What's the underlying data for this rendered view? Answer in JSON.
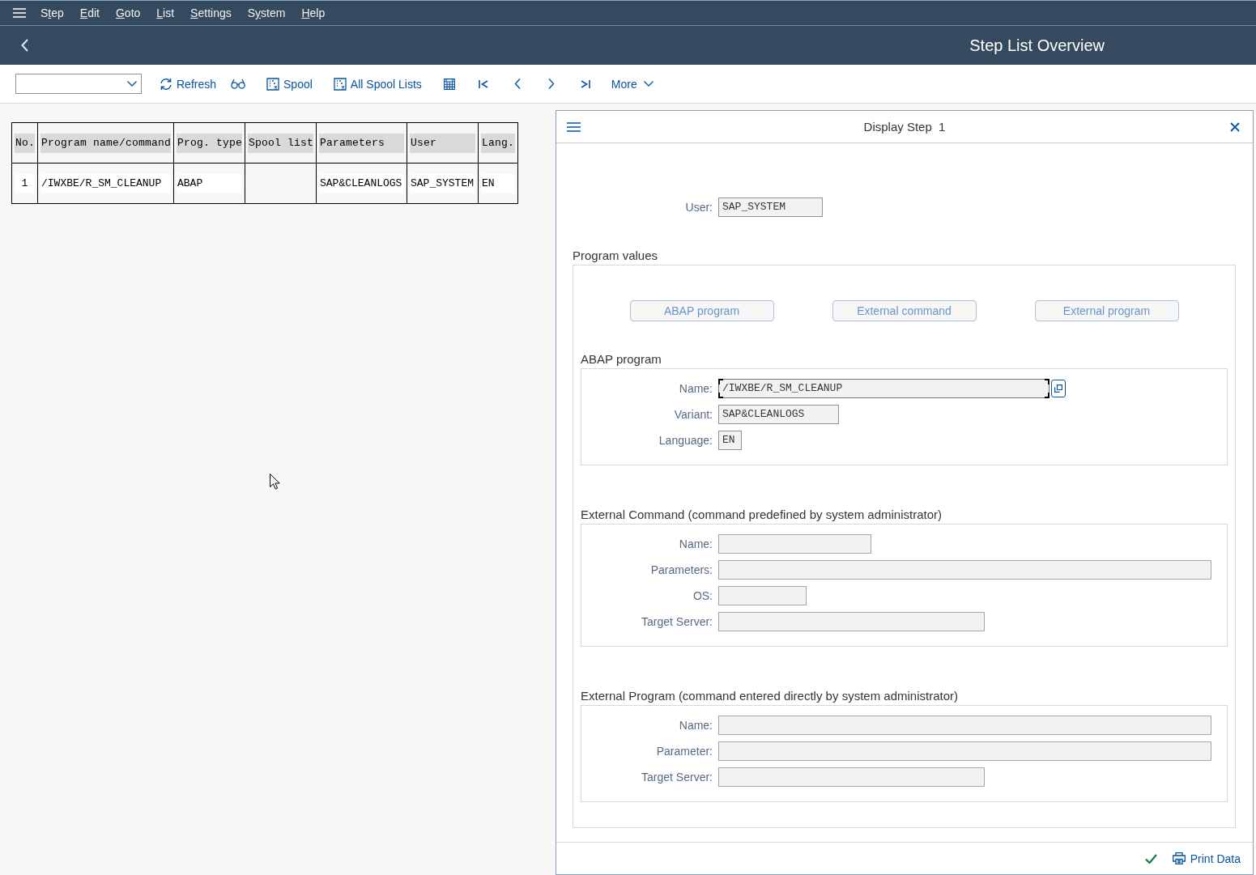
{
  "menu_bar": {
    "items": [
      {
        "before": "S",
        "underlined": "t",
        "after": "ep"
      },
      {
        "underlined": "E",
        "after": "dit"
      },
      {
        "underlined": "G",
        "after": "oto"
      },
      {
        "underlined": "L",
        "after": "ist"
      },
      {
        "underlined": "S",
        "after": "ettings"
      },
      {
        "before": "S",
        "underlined": "y",
        "after": "stem"
      },
      {
        "underlined": "H",
        "after": "elp"
      }
    ]
  },
  "title_bar": {
    "title": "Step List Overview"
  },
  "toolbar": {
    "refresh": "Refresh",
    "spool": "Spool",
    "all_spool_lists": "All Spool Lists",
    "more": "More"
  },
  "step_table": {
    "columns": [
      "No.",
      "Program name/command",
      "Prog. type",
      "Spool list",
      "Parameters",
      "User",
      "Lang."
    ],
    "rows": [
      [
        "1",
        "/IWXBE/R_SM_CLEANUP",
        "ABAP",
        null,
        "SAP&CLEANLOGS",
        "SAP_SYSTEM",
        "EN"
      ]
    ]
  },
  "dialog": {
    "title": "Display Step  1",
    "user": {
      "label": "User:",
      "value": "SAP_SYSTEM"
    },
    "program_values": {
      "heading": "Program values",
      "buttons": [
        {
          "label": "ABAP program",
          "disabled": true
        },
        {
          "label": "External command",
          "disabled": true
        },
        {
          "label": "External program",
          "disabled": true
        }
      ]
    },
    "sections": [
      {
        "heading": "ABAP program",
        "fields": [
          {
            "label": "Name:",
            "value": "/IWXBE/R_SM_CLEANUP",
            "focused": true
          },
          {
            "label": "Variant:",
            "value": "SAP&CLEANLOGS",
            "focused": false
          },
          {
            "label": "Language:",
            "value": "EN",
            "focused": false
          }
        ]
      },
      {
        "heading": "External Command (command predefined by system administrator)",
        "fields": [
          {
            "label": "Name:",
            "focused": false
          },
          {
            "label": "Parameters:",
            "focused": false
          },
          {
            "label": "OS:",
            "focused": false
          },
          {
            "label": "Target Server:",
            "focused": false
          }
        ]
      },
      {
        "heading": "External Program (command entered directly by system administrator)",
        "fields": [
          {
            "label": "Name:",
            "focused": false
          },
          {
            "label": "Parameter:",
            "focused": false
          },
          {
            "label": "Target Server:",
            "focused": false
          }
        ]
      }
    ],
    "footer": {
      "print": "Print Data"
    }
  }
}
